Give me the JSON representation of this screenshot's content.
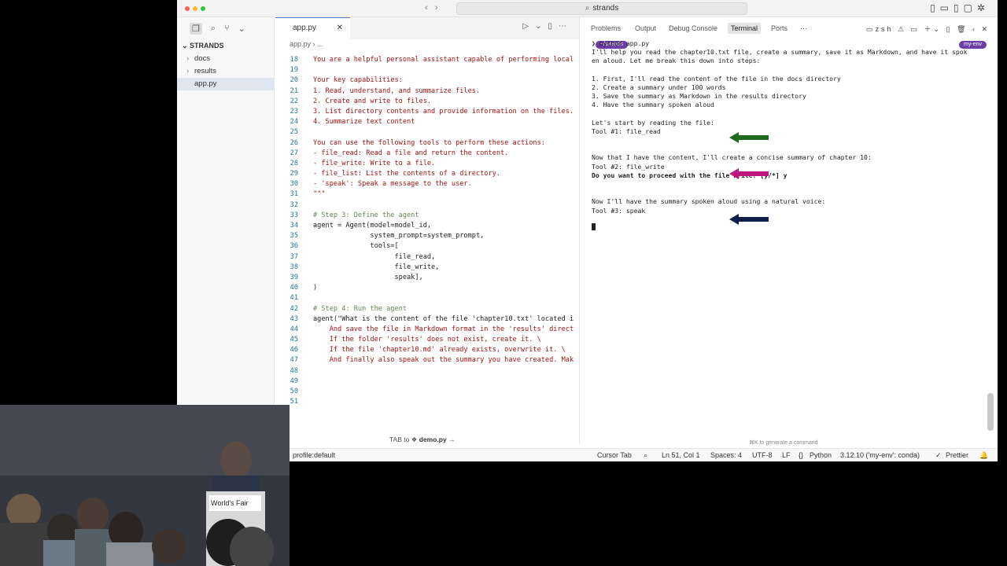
{
  "window": {
    "title": "strands"
  },
  "sidebar": {
    "root": "STRANDS",
    "items": [
      {
        "label": "docs"
      },
      {
        "label": "results"
      },
      {
        "label": "app.py"
      }
    ]
  },
  "editor": {
    "tab": "app.py",
    "breadcrumb_file": "app.py",
    "breadcrumb_rest": "...",
    "hint_prefix": "TAB",
    "hint_mid": "to",
    "hint_target": "demo.py",
    "lines": [
      {
        "n": "18",
        "text": "You are a helpful personal assistant capable of performing local",
        "cls": "str"
      },
      {
        "n": "19",
        "text": "",
        "cls": ""
      },
      {
        "n": "20",
        "text": "Your key capabilities:",
        "cls": "str"
      },
      {
        "n": "21",
        "text": "1. Read, understand, and summarize files.",
        "cls": "str"
      },
      {
        "n": "22",
        "text": "2. Create and write to files.",
        "cls": "str"
      },
      {
        "n": "23",
        "text": "3. List directory contents and provide information on the files.",
        "cls": "str"
      },
      {
        "n": "24",
        "text": "4. Summarize text content",
        "cls": "str"
      },
      {
        "n": "25",
        "text": "",
        "cls": ""
      },
      {
        "n": "26",
        "text": "You can use the following tools to perform these actions:",
        "cls": "str"
      },
      {
        "n": "27",
        "text": "- file_read: Read a file and return the content.",
        "cls": "str"
      },
      {
        "n": "28",
        "text": "- file_write: Write to a file.",
        "cls": "str"
      },
      {
        "n": "29",
        "text": "- file_list: List the contents of a directory.",
        "cls": "str"
      },
      {
        "n": "30",
        "text": "- 'speak': Speak a message to the user.",
        "cls": "str"
      },
      {
        "n": "31",
        "text": "\"\"\"",
        "cls": "str"
      },
      {
        "n": "32",
        "text": "",
        "cls": ""
      },
      {
        "n": "33",
        "text": "# Step 3: Define the agent",
        "cls": "cmt"
      },
      {
        "n": "34",
        "text": "agent = Agent(model=model_id,",
        "cls": ""
      },
      {
        "n": "35",
        "text": "              system_prompt=system_prompt,",
        "cls": ""
      },
      {
        "n": "36",
        "text": "              tools=[",
        "cls": ""
      },
      {
        "n": "37",
        "text": "                    file_read,",
        "cls": ""
      },
      {
        "n": "38",
        "text": "                    file_write,",
        "cls": ""
      },
      {
        "n": "39",
        "text": "                    speak],",
        "cls": ""
      },
      {
        "n": "40",
        "text": ")",
        "cls": ""
      },
      {
        "n": "41",
        "text": "",
        "cls": ""
      },
      {
        "n": "42",
        "text": "# Step 4: Run the agent",
        "cls": "cmt"
      },
      {
        "n": "43",
        "text": "agent(\"What is the content of the file 'chapter10.txt' located i",
        "cls": ""
      },
      {
        "n": "44",
        "text": "    And save the file in Markdown format in the 'results' direct",
        "cls": "str"
      },
      {
        "n": "45",
        "text": "    If the folder 'results' does not exist, create it. \\",
        "cls": "str"
      },
      {
        "n": "46",
        "text": "    If the file 'chapter10.md' already exists, overwrite it. \\",
        "cls": "str"
      },
      {
        "n": "47",
        "text": "    And finally also speak out the summary you have created. Mak",
        "cls": "str"
      },
      {
        "n": "48",
        "text": "",
        "cls": ""
      },
      {
        "n": "49",
        "text": "",
        "cls": ""
      },
      {
        "n": "50",
        "text": "",
        "cls": ""
      },
      {
        "n": "51",
        "text": "",
        "cls": ""
      }
    ]
  },
  "panel": {
    "tabs": [
      "Problems",
      "Output",
      "Debug Console",
      "Terminal",
      "Ports"
    ],
    "shell": "zsh",
    "prompt_dir": "~/strands",
    "env_badge": "my-env",
    "gen_hint": "⌘K to generate a command",
    "terminal_lines": [
      {
        "text": "❯ python app.py",
        "bold": false
      },
      {
        "text": "I'll help you read the chapter10.txt file, create a summary, save it as Markdown, and have it spok",
        "bold": false
      },
      {
        "text": "en aloud. Let me break this down into steps:",
        "bold": false
      },
      {
        "text": "",
        "bold": false
      },
      {
        "text": "1. First, I'll read the content of the file in the docs directory",
        "bold": false
      },
      {
        "text": "2. Create a summary under 100 words",
        "bold": false
      },
      {
        "text": "3. Save the summary as Markdown in the results directory",
        "bold": false
      },
      {
        "text": "4. Have the summary spoken aloud",
        "bold": false
      },
      {
        "text": "",
        "bold": false
      },
      {
        "text": "Let's start by reading the file:",
        "bold": false
      },
      {
        "text": "Tool #1: file_read",
        "bold": false
      },
      {
        "text": "",
        "bold": false
      },
      {
        "text": "",
        "bold": false
      },
      {
        "text": "Now that I have the content, I'll create a concise summary of chapter 10:",
        "bold": false
      },
      {
        "text": "Tool #2: file_write",
        "bold": false
      },
      {
        "text": "Do you want to proceed with the file write? [y/*] y",
        "bold": true
      },
      {
        "text": "",
        "bold": false
      },
      {
        "text": "",
        "bold": false
      },
      {
        "text": "Now I'll have the summary spoken aloud using a natural voice:",
        "bold": false
      },
      {
        "text": "Tool #3: speak",
        "bold": false
      }
    ]
  },
  "statusbar": {
    "profile": "profile:default",
    "cursor_tab": "Cursor Tab",
    "position": "Ln 51, Col 1",
    "spaces": "Spaces: 4",
    "encoding": "UTF-8",
    "eol": "LF",
    "language": "Python",
    "interpreter": "3.12.10 ('my-env': conda)",
    "formatter": "Prettier"
  },
  "webcam": {
    "podium_sign": "World's Fair"
  },
  "colors": {
    "arrow_green": "#1e6a1e",
    "arrow_magenta": "#c0157f",
    "arrow_navy": "#0f1e4a",
    "badge_purple": "#6b3ea8"
  }
}
